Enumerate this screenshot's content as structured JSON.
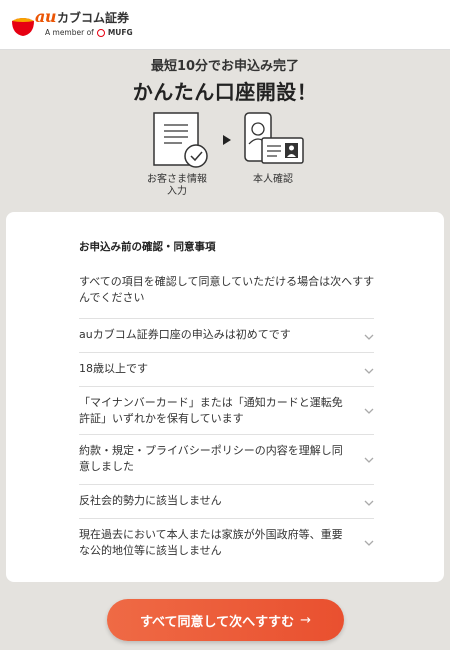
{
  "header": {
    "logo_au": "au",
    "brand": "カブコム証券",
    "member_prefix": "A member of",
    "member_group": "MUFG"
  },
  "hero": {
    "subtitle": "最短10分でお申込み完了",
    "title": "かんたん口座開設！"
  },
  "steps": [
    {
      "label": "お客さま情報\n入力",
      "icon": "form-checklist-icon"
    },
    {
      "label": "本人確認",
      "icon": "id-card-person-icon"
    }
  ],
  "consent": {
    "title": "お申込み前の確認・同意事項",
    "intro": "すべての項目を確認して同意していただける場合は次へすすんでください",
    "items": [
      {
        "text": "auカブコム証券口座の申込みは初めてです"
      },
      {
        "text": "18歳以上です"
      },
      {
        "text": "「マイナンバーカード」または「通知カードと運転免許証」いずれかを保有しています"
      },
      {
        "text": "約款・規定・プライバシーポリシーの内容を理解し同意しました"
      },
      {
        "text": "反社会的勢力に該当しません"
      },
      {
        "text": "現在過去において本人または家族が外国政府等、重要な公的地位等に該当しません"
      }
    ]
  },
  "cta": {
    "label": "すべて同意して次へすすむ",
    "arrow": "→"
  },
  "colors": {
    "brand_orange": "#eb5505",
    "cta_start": "#ef6a45",
    "cta_end": "#e9502f",
    "mufg_red": "#e60012",
    "background": "#e4e2de"
  }
}
